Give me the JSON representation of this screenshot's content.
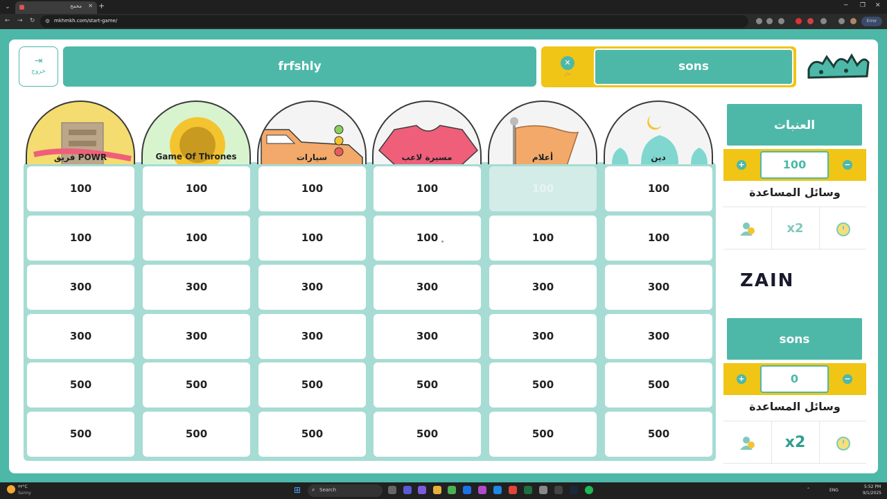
{
  "browser": {
    "tab_title": "مخمخ",
    "url": "mkhmkh.com/start-game/",
    "error_label": "Error"
  },
  "header": {
    "exit_label": "خروج",
    "team_left": "frfshly",
    "team_turn": "sons",
    "swap_label": "بدل"
  },
  "categories": [
    {
      "title": "دين",
      "values": [
        "100",
        "100",
        "300",
        "300",
        "500",
        "500"
      ]
    },
    {
      "title": "أعلام",
      "values": [
        "100",
        "100",
        "300",
        "300",
        "500",
        "500"
      ]
    },
    {
      "title": "مسيرة لاعب",
      "values": [
        "100",
        "100",
        "300",
        "300",
        "500",
        "500"
      ]
    },
    {
      "title": "سيارات",
      "values": [
        "100",
        "100",
        "300",
        "300",
        "500",
        "500"
      ]
    },
    {
      "title": "Game Of Thrones",
      "values": [
        "100",
        "100",
        "300",
        "300",
        "500",
        "500"
      ]
    },
    {
      "title": "فريق POWR",
      "values": [
        "100",
        "100",
        "300",
        "300",
        "500",
        "500"
      ]
    }
  ],
  "teams": [
    {
      "name": "العنبات",
      "score": "100",
      "aids_label": "وسائل المساعدة"
    },
    {
      "name": "sons",
      "score": "0",
      "aids_label": "وسائل المساعدة"
    }
  ],
  "aids": {
    "double_label": "x2"
  },
  "sponsor": "ZAIN",
  "taskbar": {
    "temp": "٣٣°C",
    "condition": "Sunny",
    "search_placeholder": "Search",
    "lang": "ENG",
    "time": "5:52 PM",
    "date": "9/1/2025"
  },
  "colors": {
    "teal": "#4db8a8",
    "yellow": "#f0c515",
    "used_cell": "#d3ece8"
  }
}
